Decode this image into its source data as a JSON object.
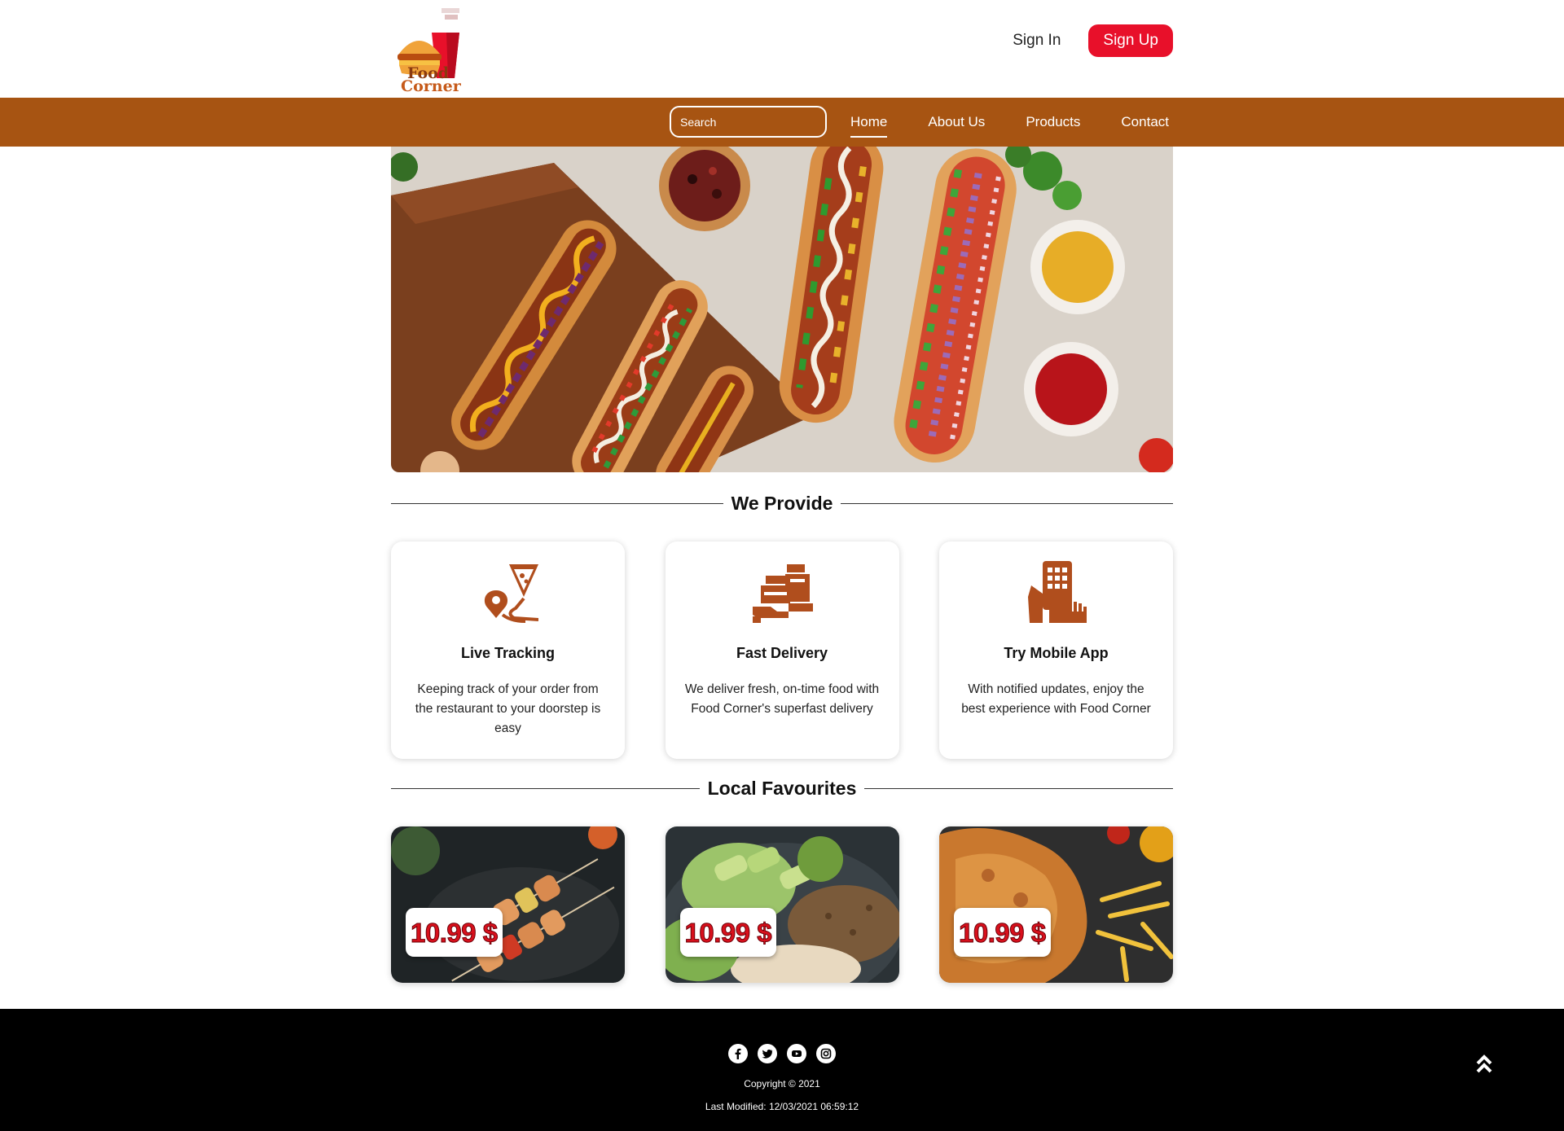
{
  "header": {
    "logo_text_line1": "Food",
    "logo_text_line2": "Corner",
    "sign_in_label": "Sign In",
    "sign_up_label": "Sign Up"
  },
  "nav": {
    "search_placeholder": "Search",
    "links": [
      "Home",
      "About Us",
      "Products",
      "Contact"
    ],
    "active_link": "Home"
  },
  "provide": {
    "title": "We Provide",
    "cards": [
      {
        "icon": "location-pizza-icon",
        "title": "Live Tracking",
        "text": "Keeping track of your order from the restaurant to your doorstep is easy"
      },
      {
        "icon": "delivery-hand-icon",
        "title": "Fast Delivery",
        "text": "We deliver fresh, on-time food with Food Corner's superfast delivery"
      },
      {
        "icon": "mobile-app-icon",
        "title": "Try Mobile App",
        "text": "With notified updates, enjoy the best experience with Food Corner"
      }
    ]
  },
  "favourites": {
    "title": "Local Favourites",
    "items": [
      {
        "price": "10.99 $",
        "image": "skewers-photo"
      },
      {
        "price": "10.99 $",
        "image": "salad-bowl-photo"
      },
      {
        "price": "10.99 $",
        "image": "fried-chicken-photo"
      }
    ]
  },
  "footer": {
    "socials": [
      "facebook-icon",
      "twitter-icon",
      "youtube-icon",
      "instagram-icon"
    ],
    "copyright": "Copyright © 2021",
    "last_modified": "Last Modified: 12/03/2021 06:59:12"
  },
  "colors": {
    "nav_bg": "#a75412",
    "accent_red": "#e8102a",
    "icon_brown": "#b04e1d",
    "footer_bg": "#000000"
  }
}
